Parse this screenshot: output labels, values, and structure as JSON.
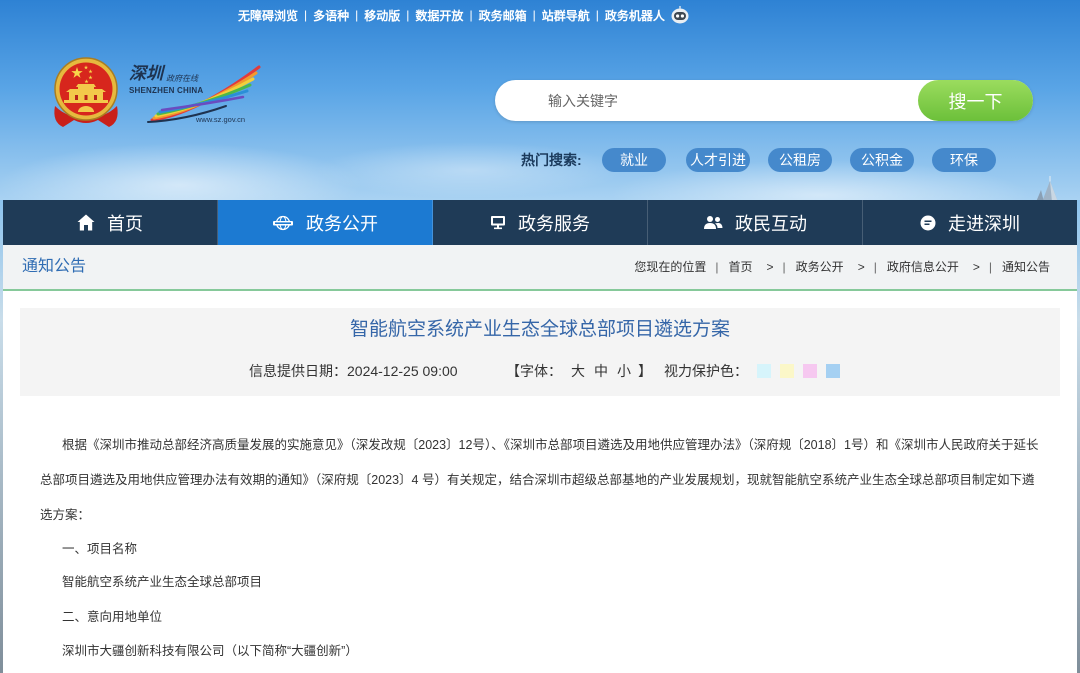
{
  "top_links": {
    "separator": "|",
    "items": [
      "无障碍浏览",
      "多语种",
      "移动版",
      "数据开放",
      "政务邮箱",
      "站群导航",
      "政务机器人"
    ],
    "robot_icon": "robot-icon"
  },
  "emblem": {
    "icon": "national-emblem-icon"
  },
  "logo": {
    "calligraphy": "深圳",
    "subtitle": "政府在线",
    "english": "SHENZHEN CHINA",
    "url": "www.sz.gov.cn",
    "icon": "shenzhen-rainbow-logo"
  },
  "search": {
    "placeholder": "输入关键字",
    "button_label": "搜一下"
  },
  "hot_search": {
    "label": "热门搜索:",
    "tags": [
      "就业",
      "人才引进",
      "公租房",
      "公积金",
      "环保"
    ]
  },
  "nav": {
    "active_index": 1,
    "items": [
      {
        "label": "首页",
        "icon": "home-icon"
      },
      {
        "label": "政务公开",
        "icon": "news-icon"
      },
      {
        "label": "政务服务",
        "icon": "monitor-icon"
      },
      {
        "label": "政民互动",
        "icon": "people-icon"
      },
      {
        "label": "走进深圳",
        "icon": "info-icon"
      }
    ]
  },
  "section": {
    "title": "通知公告"
  },
  "breadcrumb": {
    "prefix": "您现在的位置",
    "separator": "|",
    "arrow": ">",
    "items": [
      "首页",
      "政务公开",
      "政府信息公开",
      "通知公告"
    ]
  },
  "article": {
    "title": "智能航空系统产业生态全球总部项目遴选方案",
    "date_label": "信息提供日期：",
    "date": "2024-12-25 09:00",
    "font_size": {
      "open": "【字体：",
      "options": [
        "大",
        "中",
        "小"
      ],
      "close": "】"
    },
    "eye_care": {
      "label": "视力保护色：",
      "colors": [
        "#d6f4fb",
        "#fbf7c8",
        "#f6c8f0",
        "#a5d0f2"
      ]
    },
    "body": {
      "intro": "根据《深圳市推动总部经济高质量发展的实施意见》（深发改规〔2023〕12号）、《深圳市总部项目遴选及用地供应管理办法》（深府规〔2018〕1号）和《深圳市人民政府关于延长总部项目遴选及用地供应管理办法有效期的通知》（深府规〔2023〕4 号）有关规定，结合深圳市超级总部基地的产业发展规划，现就智能航空系统产业生态全球总部项目制定如下遴选方案：",
      "section1_heading": "一、项目名称",
      "section1_text": "智能航空系统产业生态全球总部项目",
      "section2_heading": "二、意向用地单位",
      "section2_text": "深圳市大疆创新科技有限公司（以下简称“大疆创新”）"
    }
  },
  "colors": {
    "nav_bg": "#1f3b57",
    "nav_active": "#1c7ad2",
    "title_blue": "#3566a8",
    "section_border": "#86c99a",
    "search_button": "#6cc03a"
  }
}
